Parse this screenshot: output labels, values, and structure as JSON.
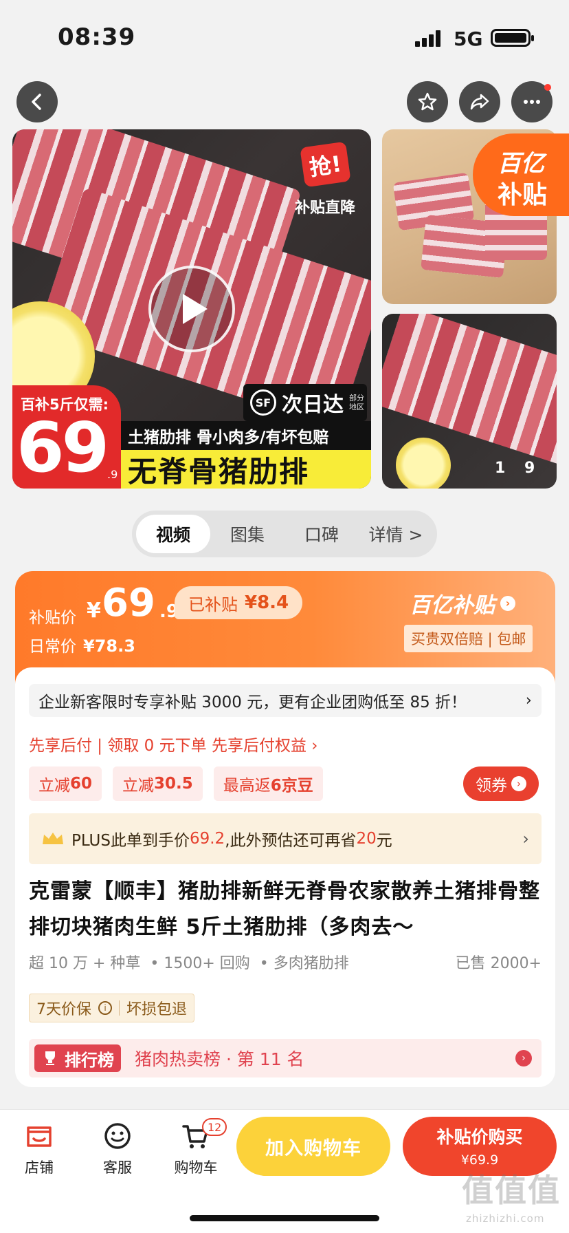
{
  "status_bar": {
    "time": "08:39",
    "network": "5G"
  },
  "gallery": {
    "badge_grab": "抢!",
    "badge_subsidy_drop": "补贴直降",
    "delivery_logo": "SF",
    "delivery_text": "次日达",
    "delivery_note": "部分地区",
    "price_badge_label": "百补5斤仅需:",
    "price_badge_int": "69",
    "price_badge_dec": ".9",
    "banner_line1": "土猪肋排 骨小肉多/有坏包赔",
    "banner_line2": "无脊骨猪肋排",
    "yi_badge_line1": "百亿",
    "yi_badge_line2": "补贴",
    "counter": "1 9"
  },
  "tabs": [
    "视频",
    "图集",
    "口碑",
    "详情 >"
  ],
  "price_card": {
    "label": "补贴价",
    "currency": "¥",
    "price_int": "69",
    "price_dec": ".9",
    "subsidized_label": "已补贴",
    "subsidized_value": "¥8.4",
    "daily_label": "日常价",
    "daily_value": "¥78.3",
    "brand": "百亿补贴",
    "tag": "买贵双倍赔 | 包邮"
  },
  "info": {
    "promo_text": "企业新客限时专享补贴 3000 元，更有企业团购低至 85 折！",
    "after_pay": "先享后付 | 领取 0 元下单 先享后付权益 ›",
    "coupons": [
      {
        "prefix": "立减",
        "value": "60"
      },
      {
        "prefix": "立减",
        "value": "30.5"
      },
      {
        "prefix": "最高返",
        "value": "6京豆"
      }
    ],
    "get_coupon": "领券",
    "plus_prefix": "PLUS此单到手价",
    "plus_price": "69.2",
    "plus_mid": ",此外预估还可再省",
    "plus_save": "20",
    "plus_suffix": "元",
    "title": "克雷蒙【顺丰】猪肋排新鲜无脊骨农家散养土猪排骨整排切块猪肉生鲜 5斤土猪肋排（多肉去～",
    "meta": [
      "超 10 万 + 种草",
      "• 1500+ 回购",
      "• 多肉猪肋排"
    ],
    "sold": "已售 2000+",
    "guarantee_1": "7天价保",
    "guarantee_2": "坏损包退",
    "rank_badge": "排行榜",
    "rank_text": "猪肉热卖榜 · 第 11 名"
  },
  "bottom_bar": {
    "shop": "店铺",
    "service": "客服",
    "cart": "购物车",
    "cart_count": "12",
    "add_cart": "加入购物车",
    "buy_line1": "补贴价购买",
    "buy_line2": "¥69.9"
  },
  "watermark": {
    "main": "值值值",
    "sub": "zhizhizhi.com"
  },
  "colors": {
    "accent": "#ff7a2a",
    "red": "#e5412f",
    "yellow": "#fcd23a"
  }
}
